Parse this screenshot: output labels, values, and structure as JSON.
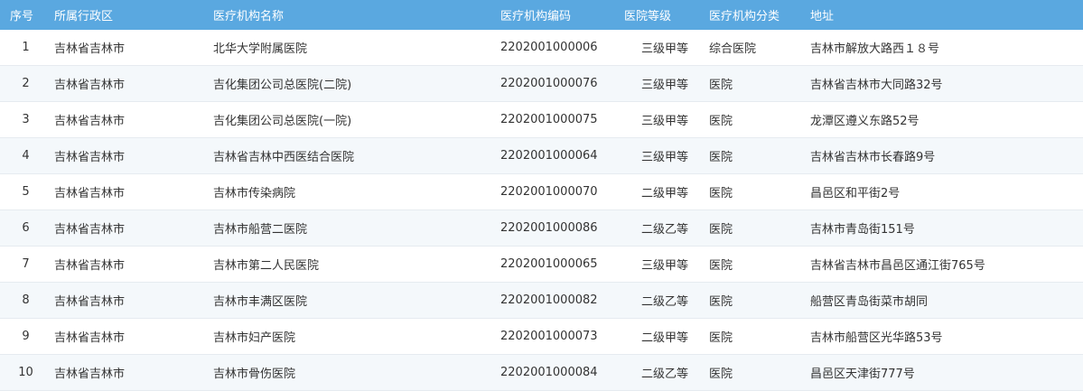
{
  "table": {
    "headers": {
      "index": "序号",
      "region": "所属行政区",
      "name": "医疗机构名称",
      "code": "医疗机构编码",
      "level": "医院等级",
      "category": "医疗机构分类",
      "address": "地址"
    },
    "rows": [
      {
        "index": "1",
        "region": "吉林省吉林市",
        "name": "北华大学附属医院",
        "code": "2202001000006",
        "level": "三级甲等",
        "category": "综合医院",
        "address": "吉林市解放大路西１８号"
      },
      {
        "index": "2",
        "region": "吉林省吉林市",
        "name": "吉化集团公司总医院(二院)",
        "code": "2202001000076",
        "level": "三级甲等",
        "category": "医院",
        "address": "吉林省吉林市大同路32号"
      },
      {
        "index": "3",
        "region": "吉林省吉林市",
        "name": "吉化集团公司总医院(一院)",
        "code": "2202001000075",
        "level": "三级甲等",
        "category": "医院",
        "address": "龙潭区遵义东路52号"
      },
      {
        "index": "4",
        "region": "吉林省吉林市",
        "name": "吉林省吉林中西医结合医院",
        "code": "2202001000064",
        "level": "三级甲等",
        "category": "医院",
        "address": "吉林省吉林市长春路9号"
      },
      {
        "index": "5",
        "region": "吉林省吉林市",
        "name": "吉林市传染病院",
        "code": "2202001000070",
        "level": "二级甲等",
        "category": "医院",
        "address": "昌邑区和平街2号"
      },
      {
        "index": "6",
        "region": "吉林省吉林市",
        "name": "吉林市船营二医院",
        "code": "2202001000086",
        "level": "二级乙等",
        "category": "医院",
        "address": "吉林市青岛街151号"
      },
      {
        "index": "7",
        "region": "吉林省吉林市",
        "name": "吉林市第二人民医院",
        "code": "2202001000065",
        "level": "三级甲等",
        "category": "医院",
        "address": "吉林省吉林市昌邑区通江街765号"
      },
      {
        "index": "8",
        "region": "吉林省吉林市",
        "name": "吉林市丰满区医院",
        "code": "2202001000082",
        "level": "二级乙等",
        "category": "医院",
        "address": "船营区青岛街菜市胡同"
      },
      {
        "index": "9",
        "region": "吉林省吉林市",
        "name": "吉林市妇产医院",
        "code": "2202001000073",
        "level": "二级甲等",
        "category": "医院",
        "address": "吉林市船营区光华路53号"
      },
      {
        "index": "10",
        "region": "吉林省吉林市",
        "name": "吉林市骨伤医院",
        "code": "2202001000084",
        "level": "二级乙等",
        "category": "医院",
        "address": "昌邑区天津街777号"
      }
    ]
  }
}
